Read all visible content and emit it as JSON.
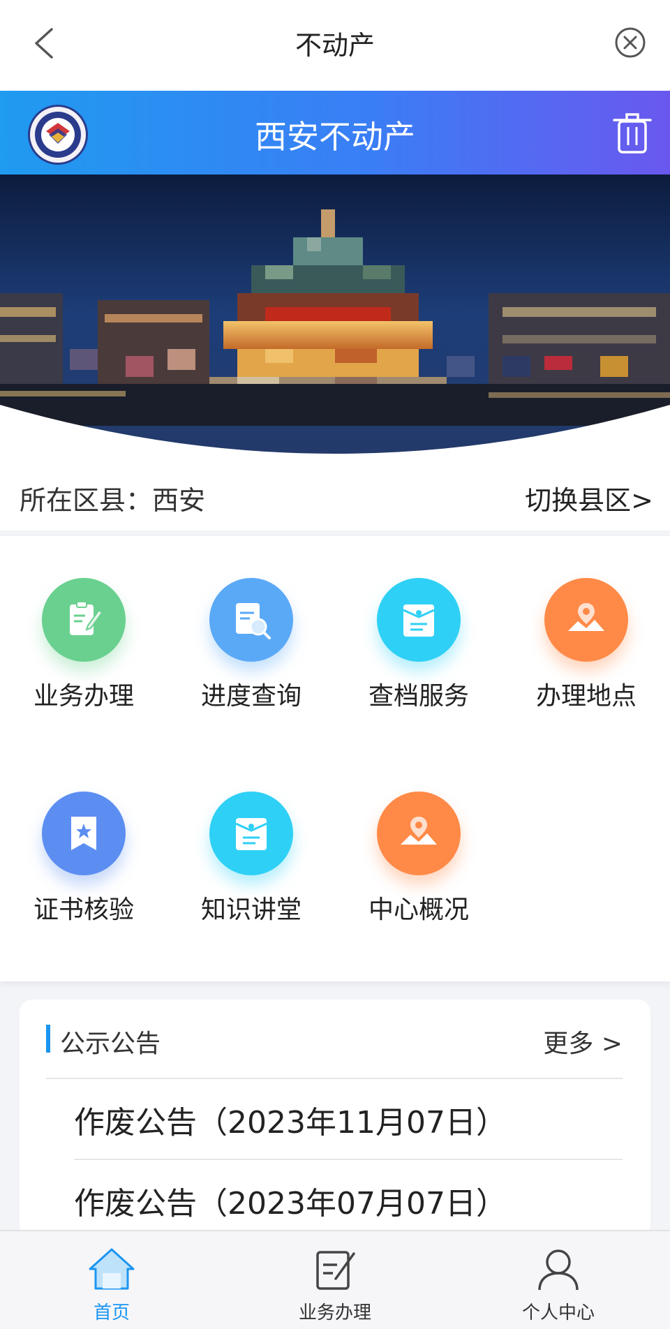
{
  "nav": {
    "title": "不动产"
  },
  "header": {
    "title": "西安不动产"
  },
  "district": {
    "current": "所在区县：西安",
    "switch_label": "切换县区>"
  },
  "grid": {
    "items": [
      {
        "label": "业务办理",
        "icon": "clipboard-edit-icon",
        "color": "#6ad08f"
      },
      {
        "label": "进度查询",
        "icon": "document-search-icon",
        "color": "#5aa9f6"
      },
      {
        "label": "查档服务",
        "icon": "folder-doc-icon",
        "color": "#2fd0f5"
      },
      {
        "label": "办理地点",
        "icon": "map-pin-icon",
        "color": "#ff8a48"
      },
      {
        "label": "证书核验",
        "icon": "certificate-star-icon",
        "color": "#5c8ef2"
      },
      {
        "label": "知识讲堂",
        "icon": "folder-doc-icon",
        "color": "#2fd0f5"
      },
      {
        "label": "中心概况",
        "icon": "map-pin-icon",
        "color": "#ff8a48"
      }
    ]
  },
  "notice": {
    "title": "公示公告",
    "more": "更多 >",
    "items": [
      "作废公告（2023年11月07日）",
      "作废公告（2023年07月07日）"
    ]
  },
  "tabbar": {
    "tabs": [
      {
        "label": "首页",
        "active": true
      },
      {
        "label": "业务办理",
        "active": false
      },
      {
        "label": "个人中心",
        "active": false
      }
    ]
  },
  "colors": {
    "accent": "#1b95f0",
    "header_start": "#1f9bf0",
    "header_end": "#6a58ee"
  }
}
